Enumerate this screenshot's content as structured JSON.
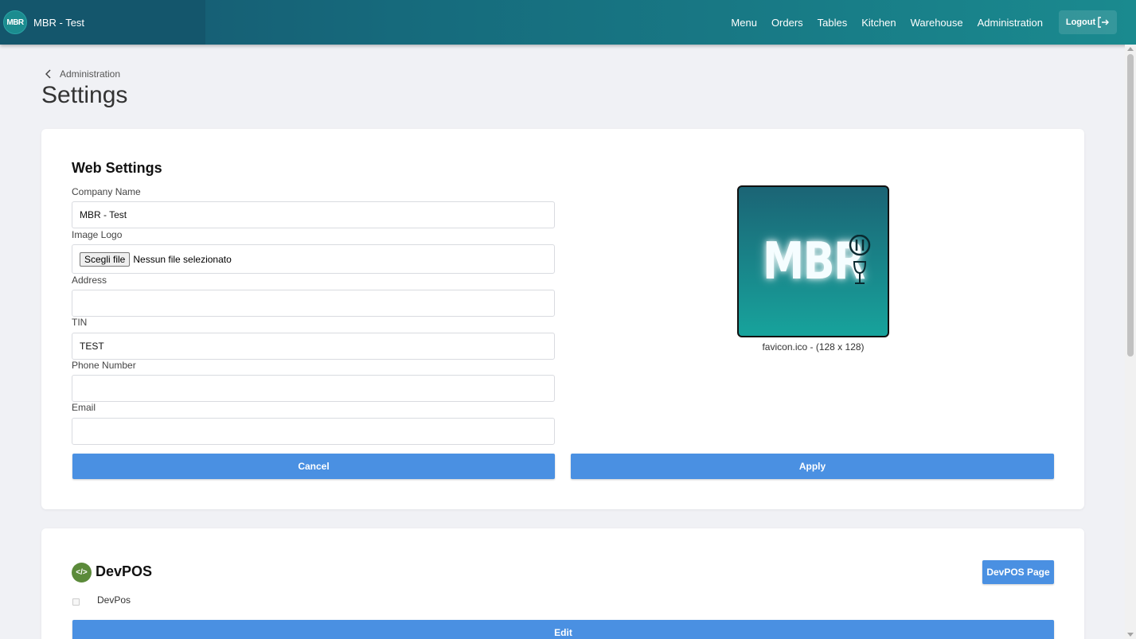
{
  "header": {
    "brand_logo": "MBR",
    "brand_name": "MBR - Test",
    "nav": [
      "Menu",
      "Orders",
      "Tables",
      "Kitchen",
      "Warehouse",
      "Administration"
    ],
    "logout_label": "Logout"
  },
  "breadcrumb": {
    "back_label": "Administration"
  },
  "page_title": "Settings",
  "web_settings": {
    "title": "Web Settings",
    "fields": {
      "company_name": {
        "label": "Company Name",
        "value": "MBR - Test"
      },
      "image_logo": {
        "label": "Image Logo",
        "button": "Scegli file",
        "status": "Nessun file selezionato"
      },
      "address": {
        "label": "Address",
        "value": ""
      },
      "tin": {
        "label": "TIN",
        "value": "TEST"
      },
      "phone": {
        "label": "Phone Number",
        "value": ""
      },
      "email": {
        "label": "Email",
        "value": ""
      }
    },
    "preview": {
      "logo_text": "MBR",
      "caption": "favicon.ico - (128 x 128)"
    },
    "cancel_label": "Cancel",
    "apply_label": "Apply"
  },
  "devpos": {
    "icon_text": "</>",
    "title": "DevPOS",
    "page_button": "DevPOS Page",
    "checkbox_label": "DevPos",
    "checkbox_checked": false,
    "edit_label": "Edit"
  },
  "colors": {
    "header": "#15556e",
    "accent_button": "#4a90e2",
    "background": "#f0f1f5",
    "devpos_icon": "#5b8a3a"
  }
}
